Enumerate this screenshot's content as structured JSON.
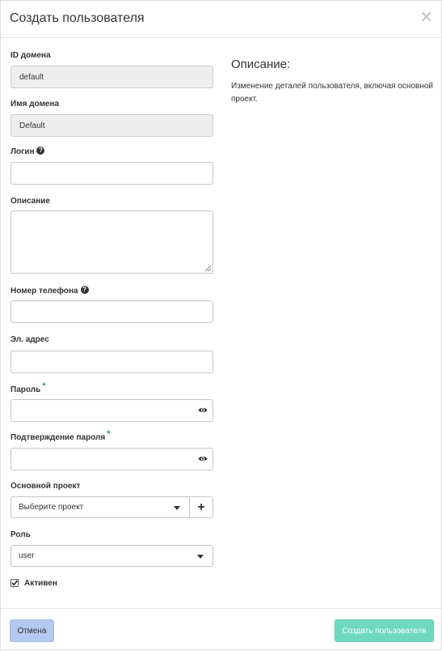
{
  "dialog": {
    "title": "Создать пользователя",
    "close_symbol": "×"
  },
  "description": {
    "heading": "Описание:",
    "text": "Изменение деталей пользователя, включая основной проект."
  },
  "form": {
    "domain_id": {
      "label": "ID домена",
      "value": "default"
    },
    "domain_name": {
      "label": "Имя домена",
      "value": "Default"
    },
    "login": {
      "label": "Логин",
      "value": ""
    },
    "description": {
      "label": "Описание",
      "value": ""
    },
    "phone": {
      "label": "Номер телефона",
      "value": ""
    },
    "email": {
      "label": "Эл. адрес",
      "value": ""
    },
    "password": {
      "label": "Пароль",
      "required_mark": "*",
      "value": ""
    },
    "password_confirm": {
      "label": "Подтверждение пароля",
      "required_mark": "*",
      "value": ""
    },
    "project": {
      "label": "Основной проект",
      "selected": "Выберите проект",
      "add_symbol": "+"
    },
    "role": {
      "label": "Роль",
      "selected": "user"
    },
    "active": {
      "label": "Активен",
      "checked": true
    }
  },
  "footer": {
    "cancel_label": "Отмена",
    "submit_label": "Создать пользователя"
  },
  "colors": {
    "required": "#19a882",
    "cancel_bg": "#b3c9f0",
    "submit_bg": "#6fd9bf"
  },
  "icons": [
    "close-icon",
    "help-icon",
    "eye-icon",
    "caret-down-icon",
    "plus-icon",
    "checkbox-checked-icon",
    "resize-grip-icon"
  ]
}
